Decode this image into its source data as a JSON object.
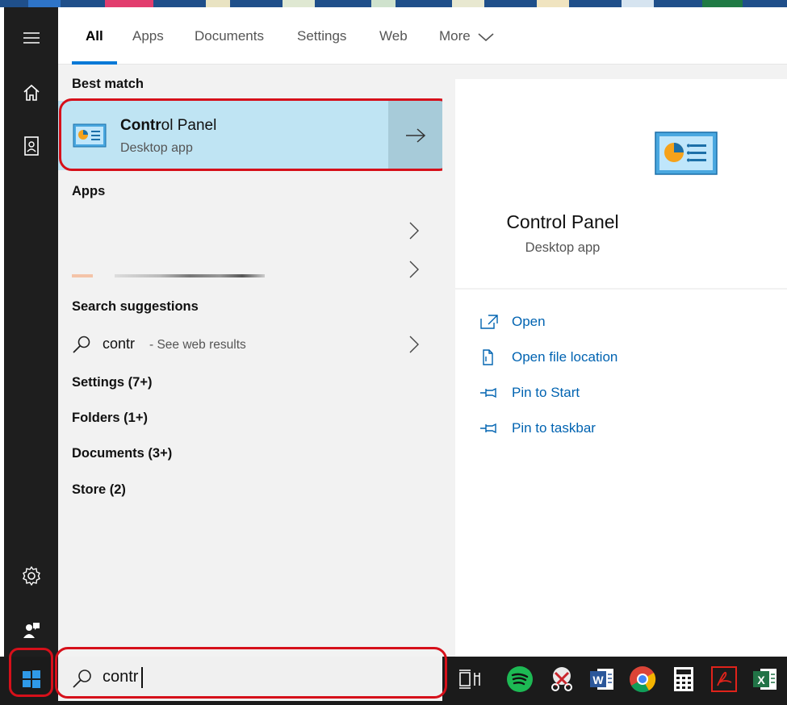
{
  "tabs": [
    {
      "label": "All"
    },
    {
      "label": "Apps"
    },
    {
      "label": "Documents"
    },
    {
      "label": "Settings"
    },
    {
      "label": "Web"
    },
    {
      "label": "More"
    }
  ],
  "best_match": {
    "heading": "Best match",
    "name_bold": "Contr",
    "name_rest": "ol Panel",
    "type": "Desktop app"
  },
  "apps": {
    "heading": "Apps"
  },
  "search_suggestions": {
    "heading": "Search suggestions",
    "query": "contr",
    "hint": "- See web results"
  },
  "categories": [
    {
      "label": "Settings (7+)"
    },
    {
      "label": "Folders (1+)"
    },
    {
      "label": "Documents (3+)"
    },
    {
      "label": "Store (2)"
    }
  ],
  "detail": {
    "name": "Control Panel",
    "type": "Desktop app",
    "actions": [
      {
        "label": "Open",
        "icon": "open-icon"
      },
      {
        "label": "Open file location",
        "icon": "file-location-icon"
      },
      {
        "label": "Pin to Start",
        "icon": "pin-icon"
      },
      {
        "label": "Pin to taskbar",
        "icon": "pin-icon"
      }
    ]
  },
  "search": {
    "value": "contr"
  },
  "taskbar_apps": [
    "task-view-icon",
    "spotify-icon",
    "snipping-tool-icon",
    "word-icon",
    "chrome-icon",
    "calculator-icon",
    "acrobat-icon",
    "excel-icon"
  ],
  "colors": {
    "accent": "#0078d7",
    "highlight": "#bfe4f3",
    "annotation": "#d6101a"
  }
}
